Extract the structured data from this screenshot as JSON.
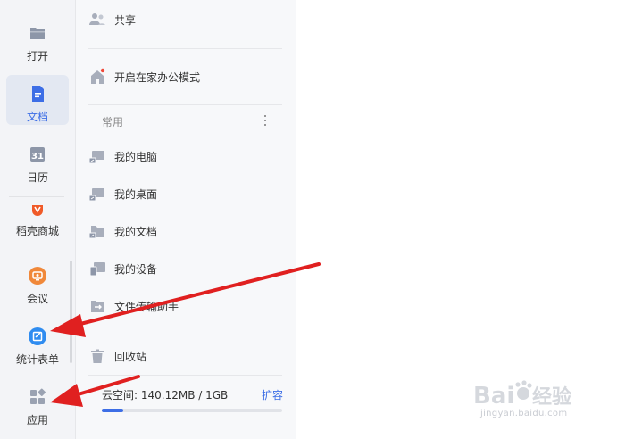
{
  "rail": {
    "items": [
      {
        "label": "打开",
        "icon": "folder-icon"
      },
      {
        "label": "文档",
        "icon": "document-icon",
        "active": true
      },
      {
        "label": "日历",
        "icon": "calendar-icon",
        "day": "31"
      },
      {
        "label": "稻壳商城",
        "icon": "docer-store-icon"
      },
      {
        "label": "会议",
        "icon": "meeting-icon"
      },
      {
        "label": "统计表单",
        "icon": "form-icon"
      },
      {
        "label": "应用",
        "icon": "apps-icon"
      }
    ]
  },
  "panel": {
    "share": "共享",
    "home_office": "开启在家办公模式",
    "section_title": "常用",
    "places": [
      "我的电脑",
      "我的桌面",
      "我的文档",
      "我的设备",
      "文件传输助手"
    ],
    "trash": "回收站",
    "storage_text": "云空间: 140.12MB / 1GB",
    "expand_label": "扩容",
    "storage_used_fraction": 0.12
  },
  "watermark": {
    "brand": "Baidu经验",
    "url": "jingyan.baidu.com"
  },
  "colors": {
    "accent": "#3d6ee6",
    "arrow": "#e02020",
    "rail_bg": "#f3f4f7",
    "panel_bg": "#f7f8fa"
  }
}
